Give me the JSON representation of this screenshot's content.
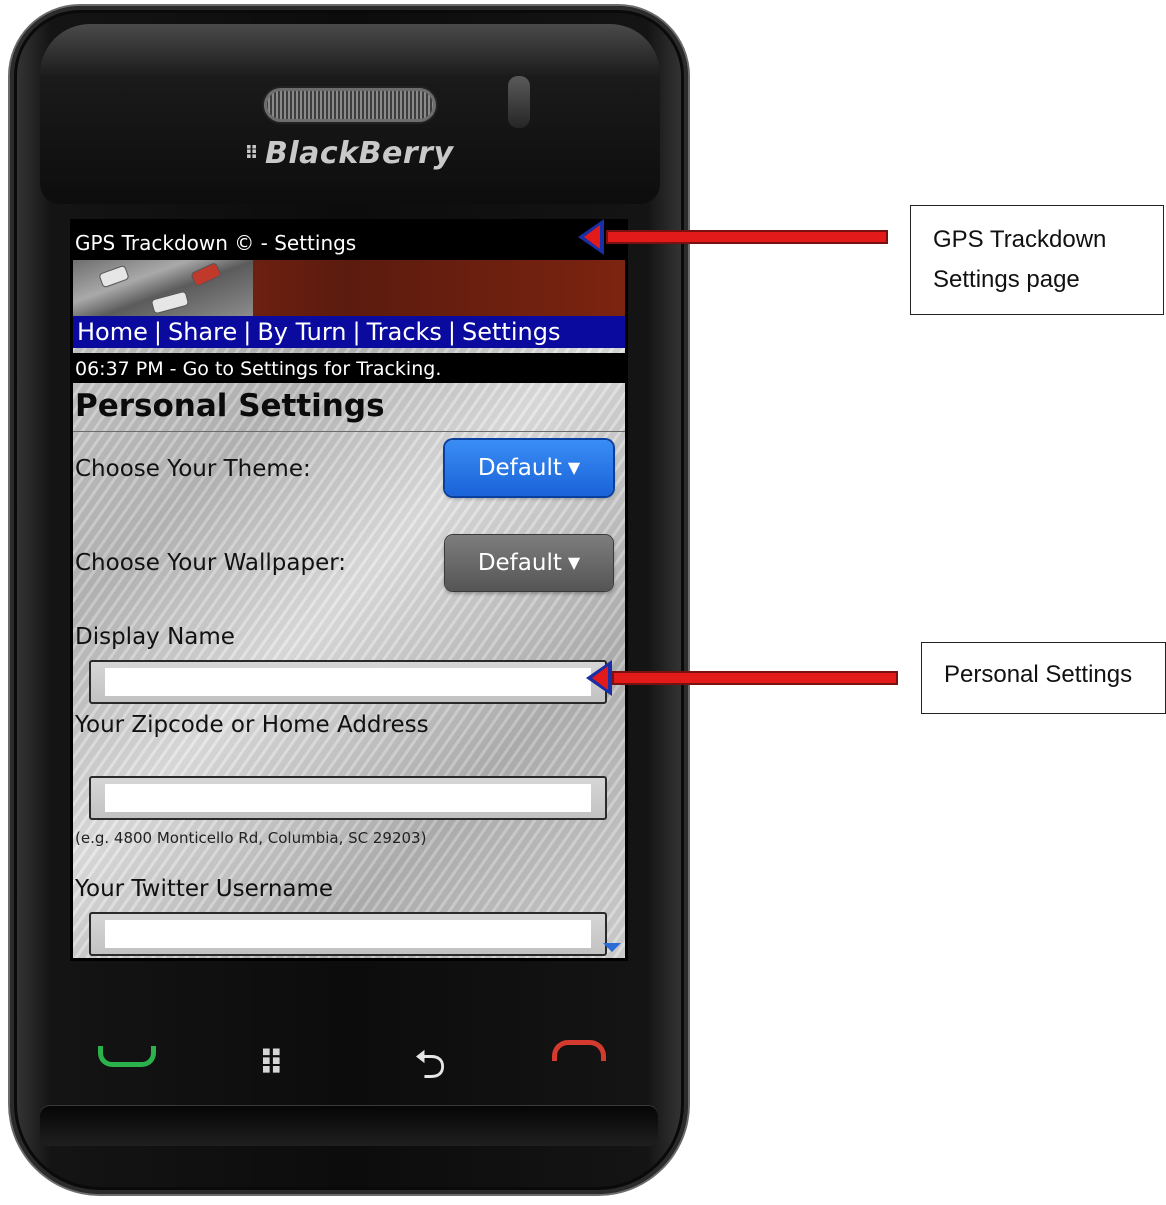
{
  "device": {
    "brand": "BlackBerry",
    "brand_logo": "⠿"
  },
  "screen": {
    "title": "GPS Trackdown ©  - Settings",
    "nav": [
      "Home",
      "Share",
      "By Turn",
      "Tracks",
      "Settings"
    ],
    "status": "06:37 PM - Go to Settings for Tracking.",
    "section_title": "Personal Settings",
    "theme": {
      "label": "Choose Your Theme:",
      "value": "Default"
    },
    "wallpaper": {
      "label": "Choose Your Wallpaper:",
      "value": "Default"
    },
    "display_name": {
      "label": "Display Name",
      "value": ""
    },
    "address": {
      "label": "Your Zipcode or Home Address",
      "value": "",
      "hint": "(e.g. 4800 Monticello Rd, Columbia, SC 29203)"
    },
    "twitter": {
      "label": "Your Twitter Username",
      "value": ""
    },
    "select_arrow": "▼"
  },
  "keys": {
    "menu_glyph": "⠿",
    "back_glyph": "⮌"
  },
  "callouts": {
    "settings_page": "GPS Trackdown Settings page",
    "personal_settings": "Personal Settings"
  },
  "colors": {
    "nav_bar": "#0a0a9e",
    "active_select": "#1a63d9",
    "arrow": "#e21a1a",
    "call_key": "#2bb24c",
    "end_key": "#d43a2e"
  }
}
